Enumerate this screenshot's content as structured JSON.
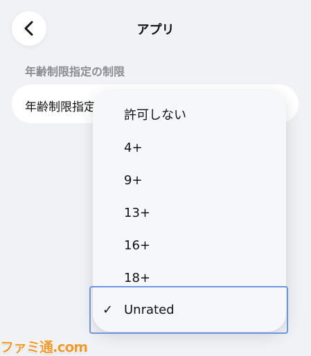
{
  "nav": {
    "back_icon": "chevron-left-icon",
    "title": "アプリ"
  },
  "section": {
    "header": "年齢制限指定の制限",
    "row_label": "年齢制限指定"
  },
  "menu": {
    "items": [
      {
        "label": "許可しない",
        "selected": false
      },
      {
        "label": "4+",
        "selected": false
      },
      {
        "label": "9+",
        "selected": false
      },
      {
        "label": "13+",
        "selected": false
      },
      {
        "label": "16+",
        "selected": false
      },
      {
        "label": "18+",
        "selected": false
      },
      {
        "label": "Unrated",
        "selected": true
      }
    ],
    "check_mark": "✓"
  },
  "watermark": {
    "text": "ファミ通.com"
  },
  "colors": {
    "background": "#f1f2f6",
    "card": "#ffffff",
    "menu": "#f6f7fb",
    "section_header": "#8a8c93",
    "highlight_border": "#6b95de",
    "watermark": "#f29a2e"
  }
}
